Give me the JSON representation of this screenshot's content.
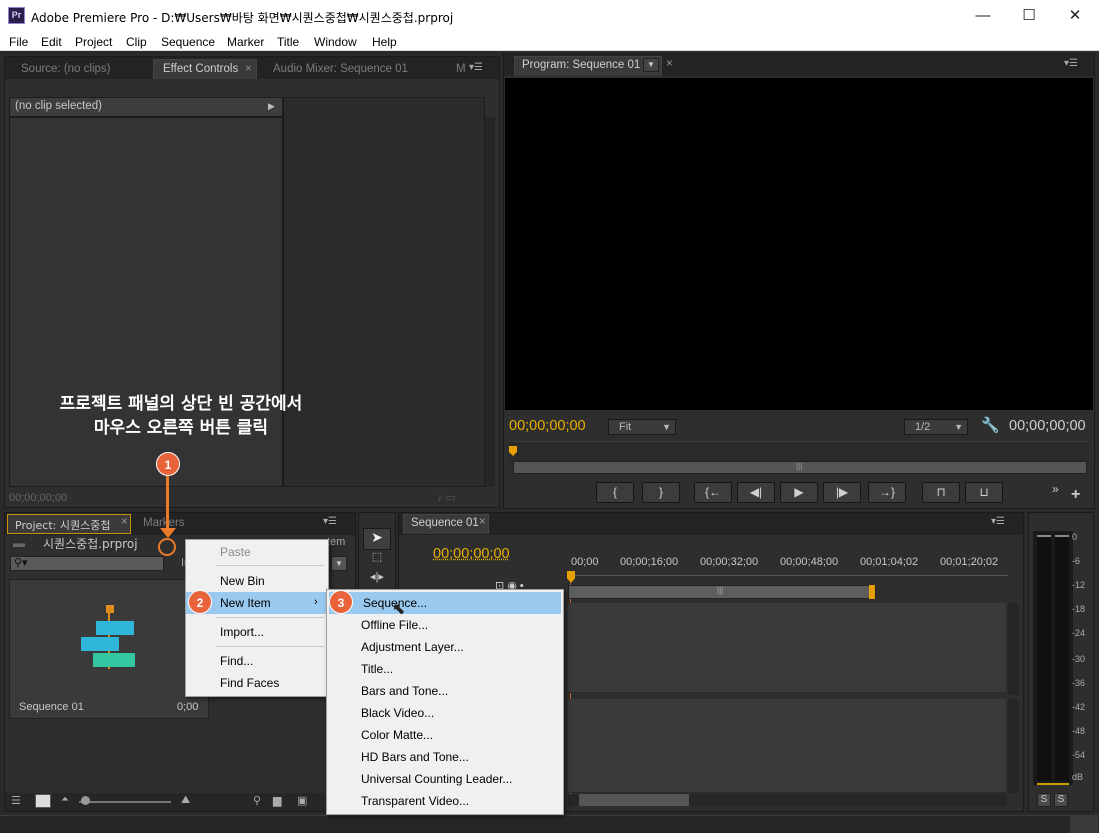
{
  "window": {
    "app_icon": "Pr",
    "title": "Adobe Premiere Pro - D:₩Users₩바탕 화면₩시퀀스중첩₩시퀀스중첩.prproj",
    "minimize": "—",
    "maximize": "☐",
    "close": "✕"
  },
  "menubar": [
    "File",
    "Edit",
    "Project",
    "Clip",
    "Sequence",
    "Marker",
    "Title",
    "Window",
    "Help"
  ],
  "source_panel": {
    "tabs": [
      "Source: (no clips)",
      "Effect Controls",
      "Audio Mixer: Sequence 01",
      "M"
    ],
    "no_clip": "(no clip selected)",
    "timecode": "00;00;00;00"
  },
  "program_monitor": {
    "tab": "Program: Sequence 01",
    "timecode_left": "00;00;00;00",
    "fit": "Fit",
    "resolution": "1/2",
    "timecode_right": "00;00;00;00",
    "controls": [
      "{",
      "}",
      "{←",
      "◀|",
      "▶",
      "|▶",
      "→}"
    ]
  },
  "annotation": {
    "line1": "프로젝트 패널의 상단 빈 공간에서",
    "line2": "마우스 오른쪽 버튼 클릭",
    "badge1": "1",
    "badge2": "2",
    "badge3": "3"
  },
  "project_panel": {
    "tab": "Project: 시퀀스중첩",
    "tab2": "Markers",
    "file": "시퀀스중첩.prproj",
    "in_label": "In:",
    "item_label": "tem",
    "item_name": "Sequence 01",
    "item_duration": "0;00"
  },
  "context_menu": {
    "items": [
      "Paste",
      "New Bin",
      "New Item",
      "Import...",
      "Find...",
      "Find Faces"
    ]
  },
  "submenu": {
    "items": [
      "Sequence...",
      "Offline File...",
      "Adjustment Layer...",
      "Title...",
      "Bars and Tone...",
      "Black Video...",
      "Color Matte...",
      "HD Bars and Tone...",
      "Universal Counting Leader...",
      "Transparent Video..."
    ]
  },
  "timeline": {
    "tab": "Sequence 01",
    "timecode": "00;00;00;00",
    "ruler": [
      "00;00",
      "00;00;16;00",
      "00;00;32;00",
      "00;00;48;00",
      "00;01;04;02",
      "00;01;20;02"
    ]
  },
  "audio_meter": {
    "ticks": [
      "0",
      "-6",
      "-12",
      "-18",
      "-24",
      "-30",
      "-36",
      "-42",
      "-48",
      "-54",
      "dB"
    ],
    "solo": [
      "S",
      "S"
    ]
  }
}
